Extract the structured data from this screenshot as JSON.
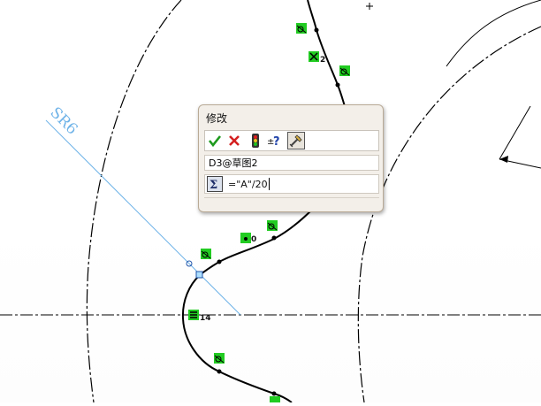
{
  "dialog": {
    "title": "修改",
    "parameter_name": "D3@草图2",
    "equation_value": "=\"A\"/20"
  },
  "toolbar_icons": [
    "check-icon",
    "x-icon",
    "traffic-light-icon",
    "plus-minus-question-icon",
    "rebuild-marker-icon"
  ],
  "sketch": {
    "dimension_text": "SR6",
    "relation_number_labels": [
      "2",
      "0",
      "14"
    ],
    "line_color": "#000000",
    "dimension_color": "#6fb3e8",
    "relation_badge_color": "#22cc22"
  }
}
